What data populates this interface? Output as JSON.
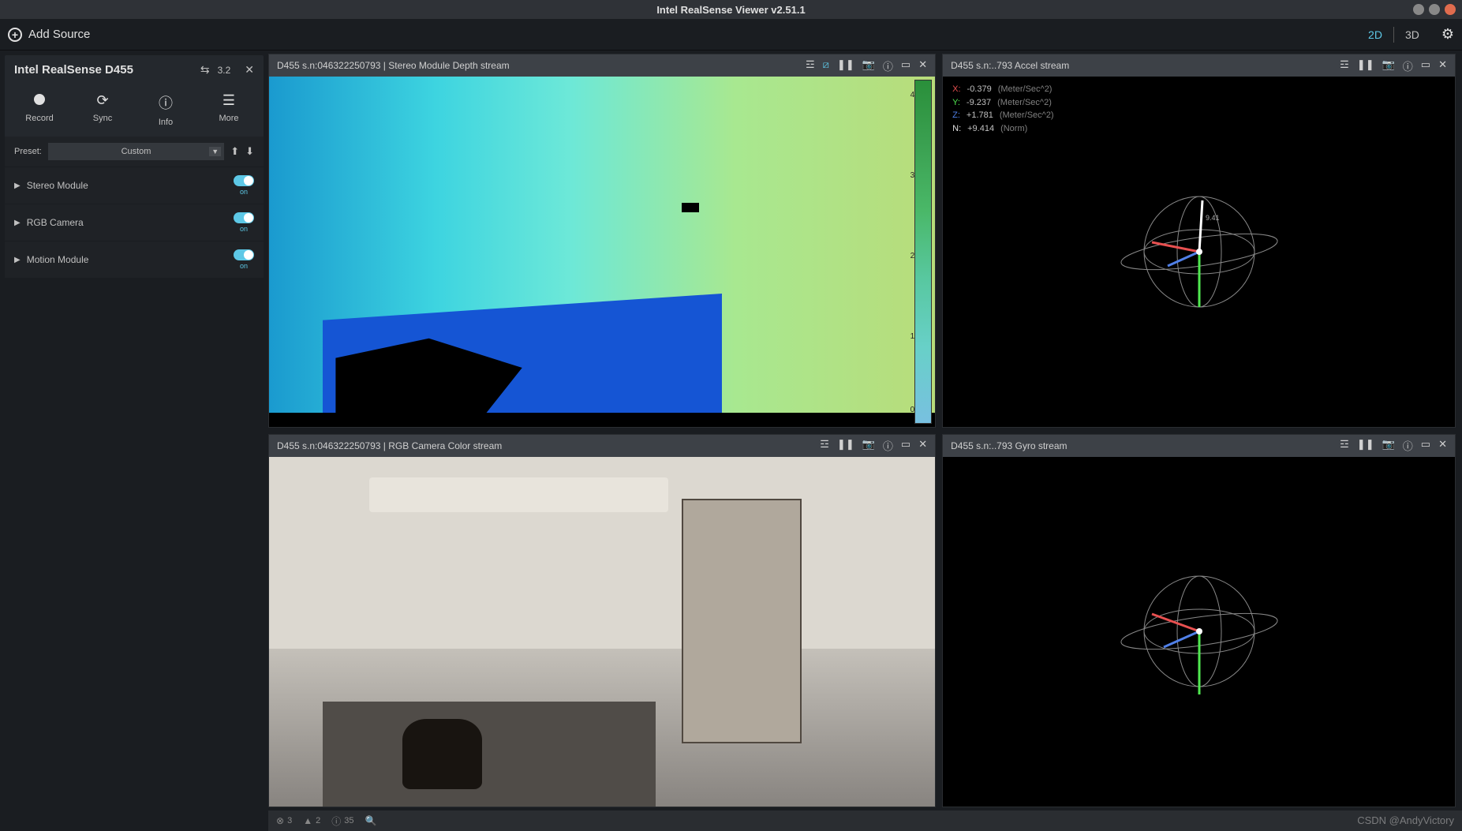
{
  "titlebar": {
    "title": "Intel RealSense Viewer v2.51.1"
  },
  "toolbar": {
    "add_source": "Add Source",
    "view_2d": "2D",
    "view_3d": "3D"
  },
  "sidebar": {
    "device_name": "Intel RealSense D455",
    "usb_version": "3.2",
    "actions": {
      "record": "Record",
      "sync": "Sync",
      "info": "Info",
      "more": "More"
    },
    "preset_label": "Preset:",
    "preset_value": "Custom",
    "modules": [
      {
        "name": "Stereo Module",
        "state": "on"
      },
      {
        "name": "RGB Camera",
        "state": "on"
      },
      {
        "name": "Motion Module",
        "state": "on"
      }
    ]
  },
  "streams": {
    "depth": {
      "title": "D455 s.n:046322250793 | Stereo Module Depth stream",
      "ticks": [
        "4",
        "3",
        "2",
        "1",
        "0"
      ]
    },
    "rgb": {
      "title": "D455 s.n:046322250793 | RGB Camera Color stream"
    },
    "accel": {
      "title": "D455 s.n:..793 Accel stream",
      "rows": [
        {
          "axis": "X:",
          "val": "-0.379",
          "unit": "(Meter/Sec^2)",
          "cls": "ax-x"
        },
        {
          "axis": "Y:",
          "val": "-9.237",
          "unit": "(Meter/Sec^2)",
          "cls": "ax-y"
        },
        {
          "axis": "Z:",
          "val": "+1.781",
          "unit": "(Meter/Sec^2)",
          "cls": "ax-z"
        },
        {
          "axis": "N:",
          "val": "+9.414",
          "unit": "(Norm)",
          "cls": "ax-n"
        }
      ],
      "marker": "9.41"
    },
    "gyro": {
      "title": "D455 s.n:..793 Gyro stream"
    }
  },
  "status": {
    "errors": "3",
    "warnings": "2",
    "info": "35"
  },
  "watermark": "CSDN @AndyVictory"
}
